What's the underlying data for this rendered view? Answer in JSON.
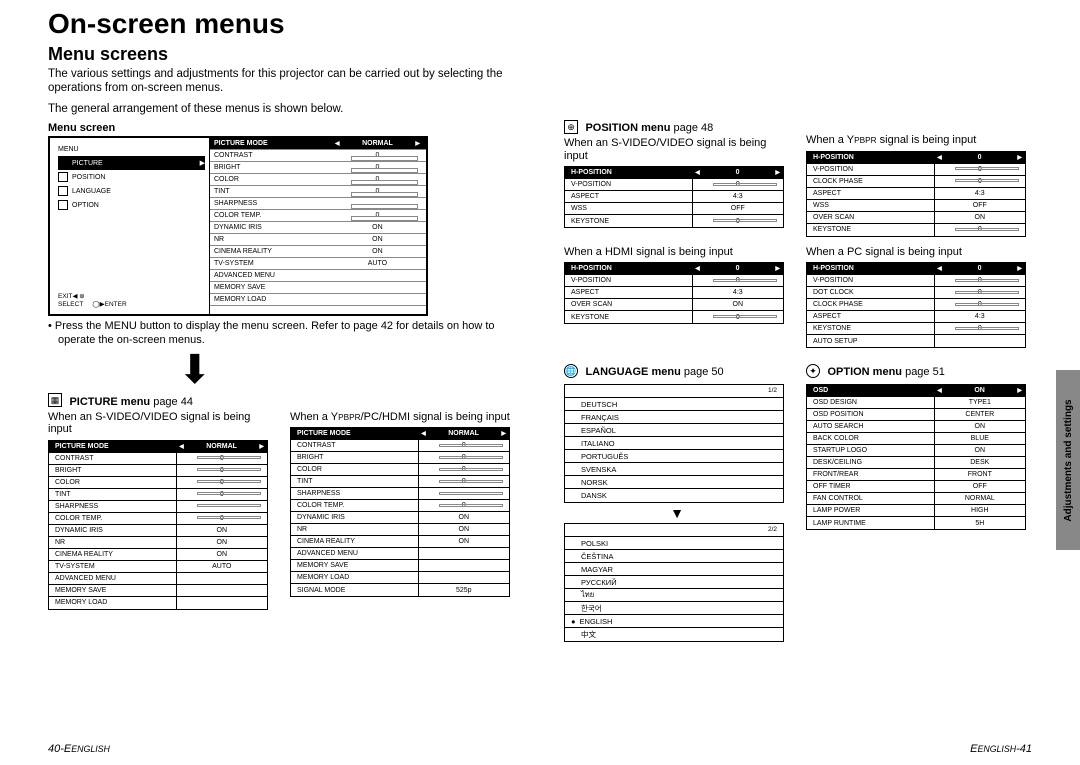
{
  "header": {
    "h1": "On-screen menus",
    "h2": "Menu screens"
  },
  "intro": {
    "p1": "The various settings and adjustments for this projector can be carried out by selecting the operations from on-screen menus.",
    "p2": "The general arrangement of these menus is shown below."
  },
  "menu_screen": {
    "label": "Menu screen",
    "left_items": [
      "MENU",
      "PICTURE",
      "POSITION",
      "LANGUAGE",
      "OPTION"
    ],
    "controls": {
      "exit": "EXIT",
      "select": "SELECT",
      "enter": "ENTER"
    },
    "rows": [
      {
        "k": "PICTURE MODE",
        "v": "NORMAL",
        "type": "select"
      },
      {
        "k": "CONTRAST",
        "v": "0",
        "type": "slider"
      },
      {
        "k": "BRIGHT",
        "v": "0",
        "type": "slider"
      },
      {
        "k": "COLOR",
        "v": "0",
        "type": "slider"
      },
      {
        "k": "TINT",
        "v": "0",
        "type": "slider"
      },
      {
        "k": "SHARPNESS",
        "v": "",
        "type": "slider"
      },
      {
        "k": "COLOR TEMP.",
        "v": "0",
        "type": "slider"
      },
      {
        "k": "DYNAMIC IRIS",
        "v": "ON",
        "type": "text"
      },
      {
        "k": "NR",
        "v": "ON",
        "type": "text"
      },
      {
        "k": "CINEMA REALITY",
        "v": "ON",
        "type": "text"
      },
      {
        "k": "TV-SYSTEM",
        "v": "AUTO",
        "type": "text"
      },
      {
        "k": "ADVANCED MENU",
        "v": "",
        "type": "text"
      },
      {
        "k": "MEMORY SAVE",
        "v": "",
        "type": "text"
      },
      {
        "k": "MEMORY LOAD",
        "v": "",
        "type": "text"
      }
    ],
    "bullet": "Press the MENU button to display the menu screen. Refer to page 42 for details on how to operate the on-screen menus."
  },
  "picture": {
    "title": "PICTURE menu",
    "ref": " page 44",
    "cond1": "When an S-VIDEO/VIDEO signal is being input",
    "cond2_pre": "When a Y",
    "cond2_sub": "PBPR",
    "cond2_post": "/PC/HDMI signal is being input",
    "table1": [
      {
        "k": "PICTURE MODE",
        "v": "NORMAL",
        "hdr": true
      },
      {
        "k": "CONTRAST",
        "v": "0",
        "slider": true
      },
      {
        "k": "BRIGHT",
        "v": "0",
        "slider": true
      },
      {
        "k": "COLOR",
        "v": "0",
        "slider": true
      },
      {
        "k": "TINT",
        "v": "0",
        "slider": true
      },
      {
        "k": "SHARPNESS",
        "v": "",
        "slider": true
      },
      {
        "k": "COLOR TEMP.",
        "v": "0",
        "slider": true
      },
      {
        "k": "DYNAMIC IRIS",
        "v": "ON"
      },
      {
        "k": "NR",
        "v": "ON"
      },
      {
        "k": "CINEMA REALITY",
        "v": "ON"
      },
      {
        "k": "TV-SYSTEM",
        "v": "AUTO"
      },
      {
        "k": "ADVANCED MENU",
        "v": ""
      },
      {
        "k": "MEMORY SAVE",
        "v": ""
      },
      {
        "k": "MEMORY LOAD",
        "v": ""
      }
    ],
    "table2": [
      {
        "k": "PICTURE MODE",
        "v": "NORMAL",
        "hdr": true
      },
      {
        "k": "CONTRAST",
        "v": "0",
        "slider": true
      },
      {
        "k": "BRIGHT",
        "v": "0",
        "slider": true
      },
      {
        "k": "COLOR",
        "v": "0",
        "slider": true
      },
      {
        "k": "TINT",
        "v": "0",
        "slider": true
      },
      {
        "k": "SHARPNESS",
        "v": "",
        "slider": true
      },
      {
        "k": "COLOR TEMP.",
        "v": "0",
        "slider": true
      },
      {
        "k": "DYNAMIC IRIS",
        "v": "ON"
      },
      {
        "k": "NR",
        "v": "ON"
      },
      {
        "k": "CINEMA REALITY",
        "v": "ON"
      },
      {
        "k": "ADVANCED MENU",
        "v": ""
      },
      {
        "k": "MEMORY SAVE",
        "v": ""
      },
      {
        "k": "MEMORY LOAD",
        "v": ""
      },
      {
        "k": "SIGNAL MODE",
        "v": "525p"
      }
    ]
  },
  "position": {
    "title": "POSITION menu",
    "ref": " page 48",
    "c1": "When an S-VIDEO/VIDEO signal is being input",
    "c2_pre": "When a Y",
    "c2_sub": "PBPR",
    "c2_post": " signal is being input",
    "c3": "When a HDMI signal is being input",
    "c4": "When a PC signal is being input",
    "t1": [
      {
        "k": "H-POSITION",
        "v": "0",
        "hdr": true,
        "slider": true
      },
      {
        "k": "V-POSITION",
        "v": "0",
        "slider": true
      },
      {
        "k": "ASPECT",
        "v": "4:3"
      },
      {
        "k": "WSS",
        "v": "OFF"
      },
      {
        "k": "KEYSTONE",
        "v": "0",
        "slider": true
      }
    ],
    "t2": [
      {
        "k": "H-POSITION",
        "v": "0",
        "hdr": true,
        "slider": true
      },
      {
        "k": "V-POSITION",
        "v": "0",
        "slider": true
      },
      {
        "k": "CLOCK PHASE",
        "v": "0",
        "slider": true
      },
      {
        "k": "ASPECT",
        "v": "4:3"
      },
      {
        "k": "WSS",
        "v": "OFF"
      },
      {
        "k": "OVER SCAN",
        "v": "ON"
      },
      {
        "k": "KEYSTONE",
        "v": "0",
        "slider": true
      }
    ],
    "t3": [
      {
        "k": "H-POSITION",
        "v": "0",
        "hdr": true,
        "slider": true
      },
      {
        "k": "V-POSITION",
        "v": "0",
        "slider": true
      },
      {
        "k": "ASPECT",
        "v": "4:3"
      },
      {
        "k": "OVER SCAN",
        "v": "ON"
      },
      {
        "k": "KEYSTONE",
        "v": "0",
        "slider": true
      }
    ],
    "t4": [
      {
        "k": "H-POSITION",
        "v": "0",
        "hdr": true,
        "slider": true
      },
      {
        "k": "V-POSITION",
        "v": "0",
        "slider": true
      },
      {
        "k": "DOT CLOCK",
        "v": "0",
        "slider": true
      },
      {
        "k": "CLOCK PHASE",
        "v": "0",
        "slider": true
      },
      {
        "k": "ASPECT",
        "v": "4:3"
      },
      {
        "k": "KEYSTONE",
        "v": "0",
        "slider": true
      },
      {
        "k": "AUTO SETUP",
        "v": ""
      }
    ]
  },
  "language": {
    "title": "LANGUAGE menu",
    "ref": " page 50",
    "page1_ind": "1/2",
    "items1": [
      "DEUTSCH",
      "FRANÇAIS",
      "ESPAÑOL",
      "ITALIANO",
      "PORTUGUÊS",
      "SVENSKA",
      "NORSK",
      "DANSK"
    ],
    "page2_ind": "2/2",
    "items2": [
      "POLSKI",
      "ČEŠTINA",
      "MAGYAR",
      "РУССКИЙ",
      "ไทย",
      "한국어",
      "ENGLISH",
      "中文"
    ],
    "selected_index": 6
  },
  "option": {
    "title": "OPTION menu",
    "ref": " page 51",
    "rows": [
      {
        "k": "OSD",
        "v": "ON",
        "hdr": true
      },
      {
        "k": "OSD  DESIGN",
        "v": "TYPE1"
      },
      {
        "k": "OSD  POSITION",
        "v": "CENTER"
      },
      {
        "k": "AUTO SEARCH",
        "v": "ON"
      },
      {
        "k": "BACK COLOR",
        "v": "BLUE"
      },
      {
        "k": "STARTUP LOGO",
        "v": "ON"
      },
      {
        "k": "DESK/CEILING",
        "v": "DESK"
      },
      {
        "k": "FRONT/REAR",
        "v": "FRONT"
      },
      {
        "k": "OFF TIMER",
        "v": "OFF"
      },
      {
        "k": "FAN CONTROL",
        "v": "NORMAL"
      },
      {
        "k": "LAMP POWER",
        "v": "HIGH"
      },
      {
        "k": "LAMP RUNTIME",
        "v": "5H"
      }
    ]
  },
  "footer": {
    "left_num": "40-",
    "left_lang": "ENGLISH",
    "right_lang": "ENGLISH",
    "right_num": "-41"
  },
  "side_tab": "Adjustments and settings"
}
